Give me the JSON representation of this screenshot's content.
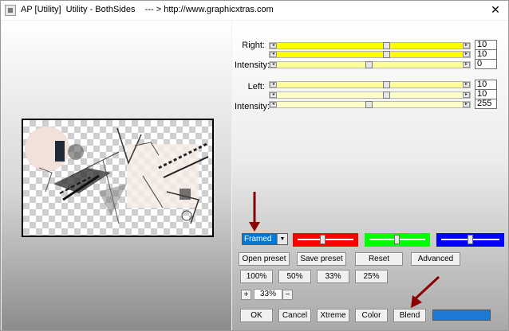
{
  "window": {
    "title": "AP [Utility]  Utility - BothSides    --- > http://www.graphicxtras.com",
    "close_glyph": "✕"
  },
  "right_group": {
    "label": "Right:",
    "intensity_label": "Intensity:",
    "values": [
      "10",
      "10",
      "0"
    ]
  },
  "left_group": {
    "label": "Left:",
    "intensity_label": "Intensity:",
    "values": [
      "10",
      "10",
      "255"
    ]
  },
  "mode_select": {
    "value": "Framed"
  },
  "color_sliders": [
    {
      "color": "#ff0000",
      "level": 0.45
    },
    {
      "color": "#00ff00",
      "level": 0.5
    },
    {
      "color": "#0000ff",
      "level": 0.5
    }
  ],
  "preset_buttons": {
    "open": "Open preset",
    "save": "Save preset",
    "reset": "Reset",
    "advanced": "Advanced"
  },
  "zoom_buttons": [
    "100%",
    "50%",
    "33%",
    "25%"
  ],
  "zoom": {
    "plus": "+",
    "value": "33%",
    "minus": "−"
  },
  "action_buttons": {
    "ok": "OK",
    "cancel": "Cancel",
    "xtreme": "Xtreme",
    "color": "Color",
    "blend": "Blend"
  },
  "colors": {
    "select_bg": "#0078d7",
    "swatch": "#1c7ad4",
    "arrow": "#8b0000"
  },
  "icons": [
    "app-icon",
    "close-icon",
    "chevron-down-icon",
    "arrow-annotation-icon"
  ]
}
